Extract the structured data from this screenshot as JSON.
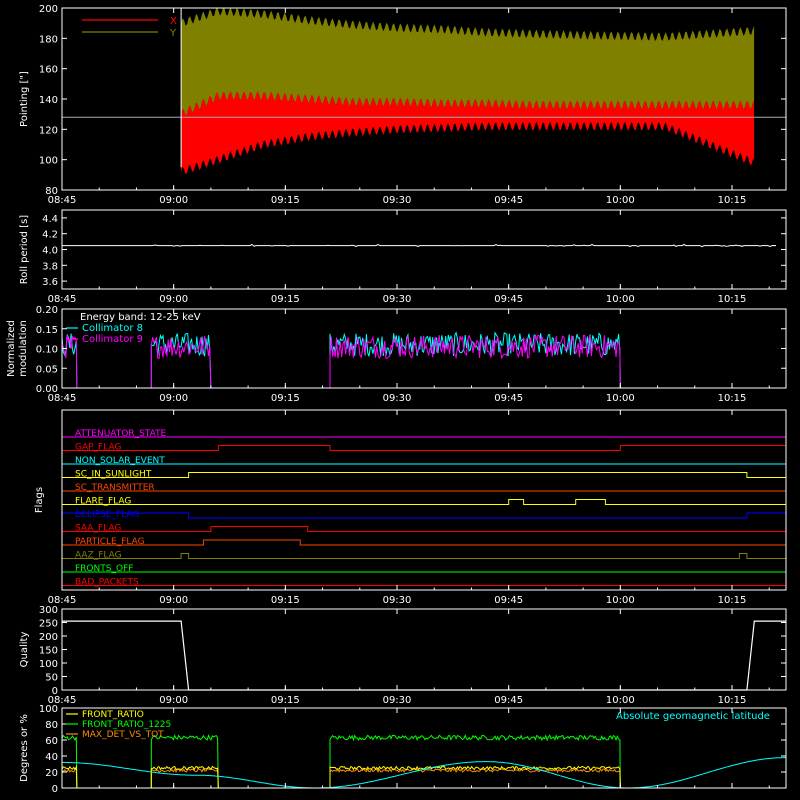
{
  "colors": {
    "background": "#000000",
    "axes": "#ffffff",
    "x_red": "#ff0000",
    "y_olive": "#808000",
    "cyan": "#00ffff",
    "magenta": "#ff00ff",
    "green": "#00ff00",
    "orange": "#ff8c00",
    "yellow": "#ffff00",
    "blue": "#0000ff",
    "flag_orange": "#ff4500",
    "olive_flag": "#7f7f00",
    "grey": "#aaaaaa"
  },
  "time_ticks": [
    "08:45",
    "09:00",
    "09:15",
    "09:30",
    "09:45",
    "10:00",
    "10:15"
  ],
  "chart_data": [
    {
      "type": "line",
      "panel": "pointing",
      "ylabel": "Pointing [\"]",
      "ylim": [
        80,
        200
      ],
      "yticks": [
        "80",
        "100",
        "120",
        "140",
        "160",
        "180",
        "200"
      ],
      "reference_line": 128,
      "series": [
        {
          "name": "X",
          "color": "#ff0000",
          "band": true,
          "lower": [
            null,
            92,
            100,
            110,
            115,
            118,
            120,
            121,
            122,
            122,
            122,
            122,
            98
          ],
          "upper": [
            null,
            130,
            142,
            142,
            140,
            138,
            138,
            137,
            137,
            136,
            136,
            136,
            136
          ]
        },
        {
          "name": "Y",
          "color": "#808000",
          "band": true,
          "lower": [
            null,
            130,
            142,
            142,
            140,
            138,
            138,
            137,
            137,
            136,
            136,
            136,
            136
          ],
          "upper": [
            null,
            190,
            198,
            196,
            192,
            189,
            187,
            186,
            184,
            183,
            182,
            181,
            185
          ]
        }
      ],
      "x": [
        "08:45",
        "09:01",
        "09:06",
        "09:12",
        "09:18",
        "09:24",
        "09:30",
        "09:36",
        "09:42",
        "09:48",
        "09:56",
        "10:06",
        "10:18"
      ]
    },
    {
      "type": "line",
      "panel": "roll",
      "ylabel": "Roll period [s]",
      "ylim": [
        3.5,
        4.5
      ],
      "yticks": [
        "3.6",
        "3.8",
        "4.0",
        "4.2",
        "4.4"
      ],
      "series": [
        {
          "name": "",
          "color": "#ffffff",
          "values": [
            4.05
          ]
        }
      ]
    },
    {
      "type": "line",
      "panel": "modulation",
      "ylabel": "Normalized modulation",
      "ylim": [
        0,
        0.2
      ],
      "yticks": [
        "0.00",
        "0.05",
        "0.10",
        "0.15",
        "0.20"
      ],
      "annotation": "Energy band: 12-25 keV",
      "intervals": [
        [
          "08:45",
          "08:47"
        ],
        [
          "08:57",
          "09:05"
        ],
        [
          "09:21",
          "10:00"
        ]
      ],
      "series": [
        {
          "name": "Collimator 8",
          "color": "#00ffff",
          "level": 0.11
        },
        {
          "name": "Collimator 9",
          "color": "#ff00ff",
          "level": 0.105
        }
      ]
    },
    {
      "type": "line",
      "panel": "flags",
      "ylabel": "Flags",
      "flags": [
        {
          "name": "ATTENUATOR_STATE",
          "color": "#ff00ff",
          "on": []
        },
        {
          "name": "GAP_FLAG",
          "color": "#ff0000",
          "on": [
            [
              "09:06",
              "09:21"
            ],
            [
              "10:00",
              "10:27"
            ]
          ]
        },
        {
          "name": "NON_SOLAR_EVENT",
          "color": "#00ffff",
          "on": []
        },
        {
          "name": "SC_IN_SUNLIGHT",
          "color": "#ffff00",
          "on": [
            [
              "09:02",
              "10:17"
            ]
          ]
        },
        {
          "name": "SC_TRANSMITTER",
          "color": "#ff4500",
          "on": []
        },
        {
          "name": "FLARE_FLAG",
          "color": "#ffff00",
          "on": [
            [
              "09:45",
              "09:47"
            ],
            [
              "09:54",
              "09:58"
            ]
          ]
        },
        {
          "name": "ECLIPSE_FLAG",
          "color": "#0000ff",
          "on": [
            [
              "08:45",
              "09:02"
            ],
            [
              "10:17",
              "10:27"
            ]
          ]
        },
        {
          "name": "SAA_FLAG",
          "color": "#ff0000",
          "on": [
            [
              "09:05",
              "09:18"
            ]
          ]
        },
        {
          "name": "PARTICLE_FLAG",
          "color": "#ff4500",
          "on": [
            [
              "09:04",
              "09:17"
            ]
          ]
        },
        {
          "name": "AAZ_FLAG",
          "color": "#7f7f00",
          "on": [
            [
              "09:01",
              "09:02"
            ],
            [
              "10:16",
              "10:17"
            ]
          ]
        },
        {
          "name": "FRONTS_OFF",
          "color": "#00ff00",
          "on": []
        },
        {
          "name": "BAD_PACKETS",
          "color": "#ff0000",
          "on": []
        }
      ]
    },
    {
      "type": "line",
      "panel": "quality",
      "ylabel": "Quality",
      "ylim": [
        0,
        300
      ],
      "yticks": [
        "0",
        "50",
        "100",
        "150",
        "200",
        "250",
        "300"
      ],
      "series": [
        {
          "name": "",
          "color": "#ffffff",
          "x": [
            "08:45",
            "09:01",
            "09:02",
            "10:17",
            "10:18",
            "10:27"
          ],
          "values": [
            255,
            255,
            0,
            0,
            255,
            255
          ]
        }
      ]
    },
    {
      "type": "line",
      "panel": "ratios",
      "ylabel": "Degrees or %",
      "ylim": [
        0,
        100
      ],
      "yticks": [
        "0",
        "20",
        "40",
        "60",
        "80",
        "100"
      ],
      "annotation": "Absolute geomagnetic latitude",
      "series": [
        {
          "name": "FRONT_RATIO",
          "color": "#ffff00",
          "level": 25
        },
        {
          "name": "FRONT_RATIO_1225",
          "color": "#00ff00",
          "level": 63
        },
        {
          "name": "MAX_DET_VS_TOT",
          "color": "#ff8c00",
          "level": 22
        },
        {
          "name": "Absolute geomagnetic latitude",
          "color": "#00ffff",
          "x": [
            "08:45",
            "09:03",
            "09:19",
            "09:42",
            "10:01",
            "10:27"
          ],
          "values": [
            32,
            16,
            0,
            33,
            0,
            38
          ]
        }
      ]
    }
  ]
}
